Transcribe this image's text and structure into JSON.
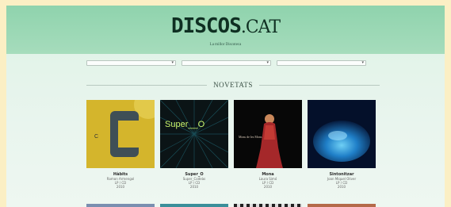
{
  "header": {
    "logo_main": "DISCOS",
    "logo_suffix": ".CAT",
    "tagline": "La millor Discoteca"
  },
  "filters": [
    {
      "value": "",
      "icon": "chevron-down-icon"
    },
    {
      "value": "",
      "icon": "chevron-down-icon"
    },
    {
      "value": "",
      "icon": "chevron-down-icon"
    }
  ],
  "section": {
    "title": "NOVETATS"
  },
  "albums": [
    {
      "title": "Hàbits",
      "line1": "Ramon Armengol",
      "line2": "LP / CD",
      "line3": "2010",
      "cover_text": "C"
    },
    {
      "title": "Super_O",
      "line1": "Super_Codeàs",
      "line2": "LP / CD",
      "line3": "2010",
      "cover_text": "Super__O"
    },
    {
      "title": "Mona",
      "line1": "Laura Simó",
      "line2": "LP / CD",
      "line3": "2010",
      "cover_text": "Mons de les Mons"
    },
    {
      "title": "Sintonitzar",
      "line1": "Joan Miquel Oliver",
      "line2": "LP / CD",
      "line3": "2010",
      "cover_text": ""
    }
  ],
  "colors": {
    "background": "#fbefc4",
    "header": "#8fd3ad",
    "page": "#e4f4ea"
  }
}
